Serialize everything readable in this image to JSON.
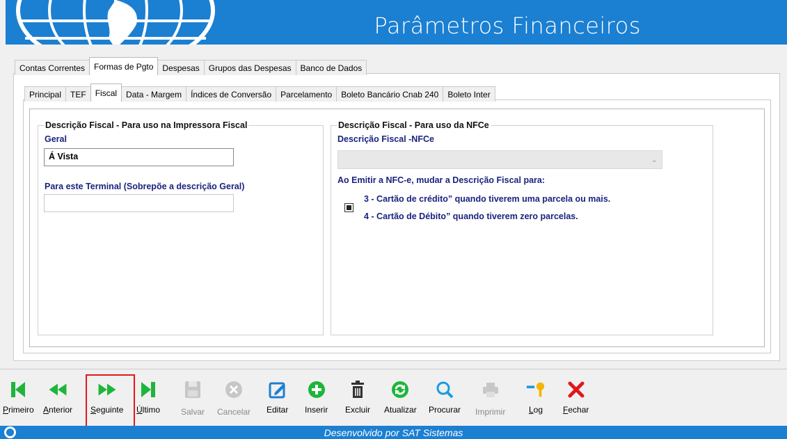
{
  "window": {
    "title": "Parâmetros Financeiros"
  },
  "tabs_main": [
    "Contas Correntes",
    "Formas de Pgto",
    "Despesas",
    "Grupos das Despesas",
    "Banco de Dados"
  ],
  "tabs_main_active": "Formas de Pgto",
  "tabs_sub": [
    "Principal",
    "TEF",
    "Fiscal",
    "Data - Margem",
    "Índices de Conversão",
    "Parcelamento",
    "Boleto Bancário Cnab 240",
    "Boleto Inter"
  ],
  "tabs_sub_active": "Fiscal",
  "printer_group": {
    "title": "Descrição Fiscal - Para uso na Impressora Fiscal",
    "general_label": "Geral",
    "general_value": "Á Vista",
    "terminal_label": "Para este Terminal (Sobrepõe a descrição Geral)",
    "terminal_value": ""
  },
  "nfce_group": {
    "title": "Descrição Fiscal - Para uso da NFCe",
    "description_label": "Descrição Fiscal -NFCe",
    "description_value": "",
    "emit_label": "Ao Emitir a NFC-e, mudar a Descrição Fiscal para:",
    "option_line1": "3 - Cartão de crédito” quando tiverem uma parcela ou mais.",
    "option_line2": "4 - Cartão de Débito” quando tiverem zero parcelas.",
    "option_checked": true
  },
  "toolbar": {
    "first": "Primeiro",
    "previous": "Anterior",
    "next": "Seguinte",
    "last": "Último",
    "save": "Salvar",
    "cancel": "Cancelar",
    "edit": "Editar",
    "insert": "Inserir",
    "delete": "Excluir",
    "refresh": "Atualizar",
    "search": "Procurar",
    "print": "Imprimir",
    "log": "Log",
    "close": "Fechar"
  },
  "footer": {
    "text": "Desenvolvido por SAT Sistemas"
  },
  "colors": {
    "header_blue": "#1b7fd2",
    "nav_green": "#1eb53a",
    "label_navy": "#1a237e",
    "close_red": "#e0181a",
    "highlight": "#e0181a"
  }
}
